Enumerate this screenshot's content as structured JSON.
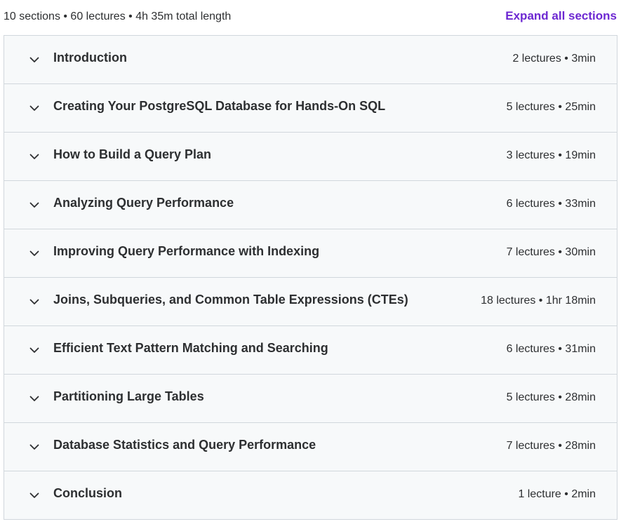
{
  "header": {
    "summary": "10 sections • 60 lectures • 4h 35m total length",
    "expand_label": "Expand all sections"
  },
  "icons": {
    "section_toggle": "chevron-down-icon"
  },
  "colors": {
    "accent": "#6d28d2",
    "text": "#2d2f31",
    "row_bg": "#f7f9fa",
    "border": "#d1d7dc"
  },
  "sections": [
    {
      "title": "Introduction",
      "meta": "2 lectures • 3min"
    },
    {
      "title": "Creating Your PostgreSQL Database for Hands-On SQL",
      "meta": "5 lectures • 25min"
    },
    {
      "title": "How to Build a Query Plan",
      "meta": "3 lectures • 19min"
    },
    {
      "title": "Analyzing Query Performance",
      "meta": "6 lectures • 33min"
    },
    {
      "title": "Improving Query Performance with Indexing",
      "meta": "7 lectures • 30min"
    },
    {
      "title": "Joins, Subqueries, and Common Table Expressions (CTEs)",
      "meta": "18 lectures • 1hr 18min"
    },
    {
      "title": "Efficient Text Pattern Matching and Searching",
      "meta": "6 lectures • 31min"
    },
    {
      "title": "Partitioning Large Tables",
      "meta": "5 lectures • 28min"
    },
    {
      "title": "Database Statistics and Query Performance",
      "meta": "7 lectures • 28min"
    },
    {
      "title": "Conclusion",
      "meta": "1 lecture • 2min"
    }
  ]
}
